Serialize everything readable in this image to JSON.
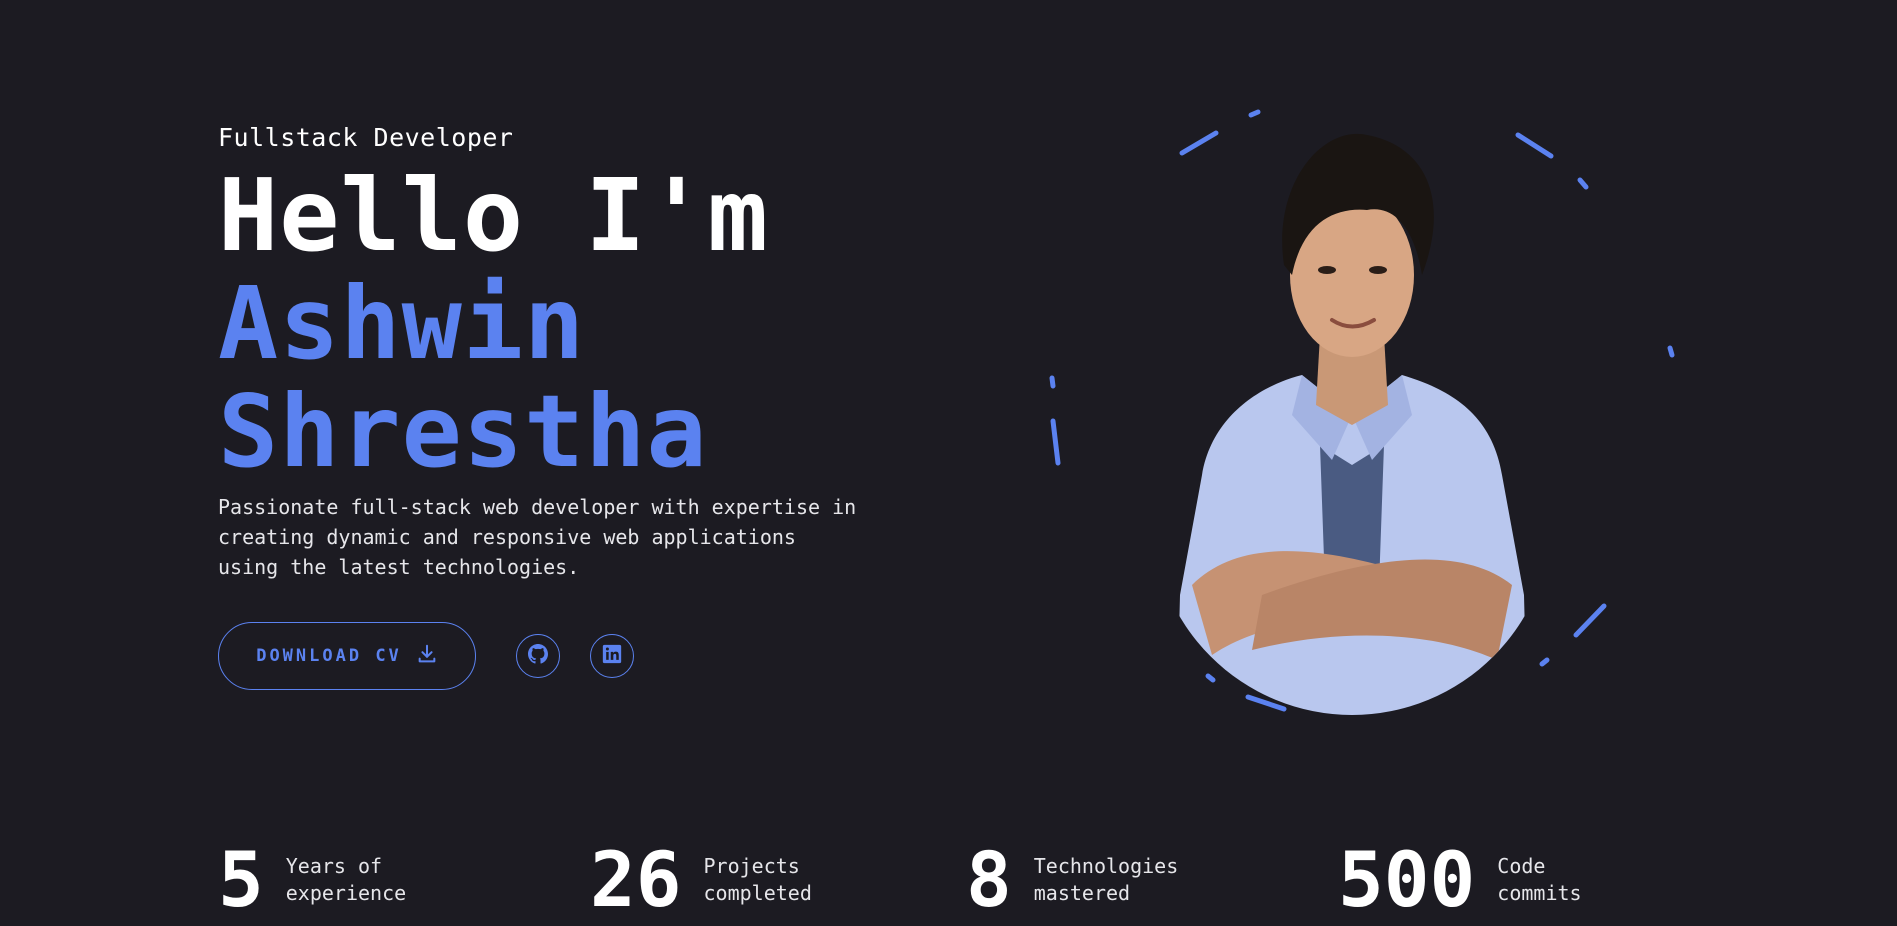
{
  "hero": {
    "role": "Fullstack Developer",
    "greeting": "Hello I'm",
    "first_name": "Ashwin",
    "last_name": "Shrestha",
    "intro": "Passionate full-stack web developer with expertise in creating dynamic and responsive web applications using the latest technologies."
  },
  "actions": {
    "download_cv_label": "DOWNLOAD CV",
    "download_icon": "download-icon",
    "social": [
      {
        "name": "github",
        "icon": "github-icon"
      },
      {
        "name": "linkedin",
        "icon": "linkedin-icon"
      }
    ]
  },
  "stats": [
    {
      "value": "5",
      "label": "Years of experience"
    },
    {
      "value": "26",
      "label": "Projects completed"
    },
    {
      "value": "8",
      "label": "Technologies mastered"
    },
    {
      "value": "500",
      "label": "Code commits"
    }
  ],
  "colors": {
    "background": "#1c1b22",
    "accent": "#5b82f0",
    "text": "#ffffff"
  }
}
